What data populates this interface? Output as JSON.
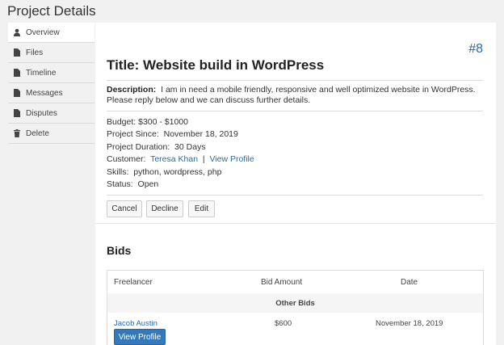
{
  "page_title": "Project Details",
  "sidebar": {
    "items": [
      {
        "label": "Overview",
        "icon": "user-icon"
      },
      {
        "label": "Files",
        "icon": "file-icon"
      },
      {
        "label": "Timeline",
        "icon": "file-icon"
      },
      {
        "label": "Messages",
        "icon": "file-icon"
      },
      {
        "label": "Disputes",
        "icon": "file-icon"
      },
      {
        "label": "Delete",
        "icon": "trash-icon"
      }
    ]
  },
  "project": {
    "number": "#8",
    "title": "Title: Website build in WordPress",
    "description_label": "Description:",
    "description": "I am in need a mobile friendly, responsive and well optimized website in WordPress. Please reply below and we can discuss further details.",
    "budget": "Budget: $300 - $1000",
    "since_label": "Project Since:",
    "since": "November 18, 2019",
    "duration_label": "Project Duration:",
    "duration": "30 Days",
    "customer_label": "Customer:",
    "customer_name": "Teresa Khan",
    "customer_sep": "|",
    "view_profile": "View Profile",
    "skills_label": "Skills:",
    "skills": "python, wordpress, php",
    "status_label": "Status:",
    "status": "Open"
  },
  "actions": {
    "cancel": "Cancel",
    "decline": "Decline",
    "edit": "Edit"
  },
  "bids": {
    "heading": "Bids",
    "columns": [
      "Freelancer",
      "Bid Amount",
      "Date"
    ],
    "group_label": "Other Bids",
    "rows": [
      {
        "freelancer": "Jacob Austin",
        "amount": "$600",
        "date": "November 18, 2019",
        "button": "View Profile"
      }
    ]
  },
  "colors": {
    "link": "#2a6aa8",
    "primary_button": "#3279bd"
  }
}
